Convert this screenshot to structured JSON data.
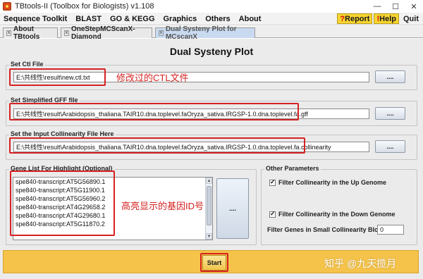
{
  "window": {
    "title": "TBtools-II (Toolbox for Biologists) v1.108",
    "controls": [
      "—",
      "☐",
      "✕"
    ]
  },
  "menu": {
    "items": [
      "Sequence Toolkit",
      "BLAST",
      "GO & KEGG",
      "Graphics",
      "Others",
      "About"
    ],
    "report": "Report",
    "help": "Help",
    "quit": "Quit"
  },
  "tabs": [
    "About TBtools",
    "OneStepMCScanX-Diamond",
    "Dual Systeny Plot for MCscanX"
  ],
  "page": {
    "title": "Dual Systeny Plot"
  },
  "ctl": {
    "label": "Set Ctl File",
    "value": "E:\\共线性\\result\\new.ctl.txt",
    "button": "....",
    "annotation": "修改过的CTL文件"
  },
  "gff": {
    "label": "Set Simplified GFF file",
    "value": "E:\\共线性\\result\\Arabidopsis_thaliana.TAIR10.dna.toplevel.faOryza_sativa.IRGSP-1.0.dna.toplevel.fa.gff",
    "button": "...."
  },
  "collinearity": {
    "label": "Set the Input Collinearity File Here",
    "value": "E:\\共线性\\result\\Arabidopsis_thaliana.TAIR10.dna.toplevel.faOryza_sativa.IRGSP-1.0.dna.toplevel.fa.collinearity",
    "button": "...."
  },
  "genelist": {
    "label": "Gene List For Highlight (Optional)",
    "genes": [
      "spe840-transcript:AT5G56890.1",
      "spe840-transcript:AT5G11900.1",
      "spe840-transcript:AT5G56960.2",
      "spe840-transcript:AT4G29658.2",
      "spe840-transcript:AT4G29680.1",
      "spe840-transcript:AT5G11870.2"
    ],
    "button": "....",
    "annotation": "高亮显示的基因ID号"
  },
  "other_params": {
    "label": "Other Parameters",
    "filter_up": {
      "label": "Filter Collinearity in the Up Genome",
      "checked": true
    },
    "filter_down": {
      "label": "Filter Collinearity in the Down Genome",
      "checked": true
    },
    "small_block": {
      "label": "Filter Genes in Small Collinearity Block :",
      "value": "0"
    }
  },
  "start": {
    "label": "Start"
  },
  "watermark": "知乎 @九天揽月",
  "colors": {
    "annotation": "#d62222",
    "start_bar": "#f5c34a",
    "active_tab": "#c9daf0",
    "menu_chip": "#f7d531"
  }
}
